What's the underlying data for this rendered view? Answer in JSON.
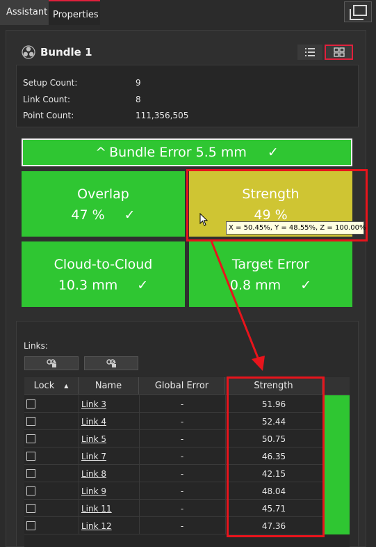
{
  "tabs": [
    {
      "label": "Assistant"
    },
    {
      "label": "Properties"
    }
  ],
  "bundle": {
    "title": "Bundle 1",
    "info": [
      {
        "key": "Setup Count:",
        "value": "9"
      },
      {
        "key": "Link Count:",
        "value": "8"
      },
      {
        "key": "Point Count:",
        "value": "111,356,505"
      }
    ]
  },
  "bundle_error": {
    "chevron": "^",
    "label": "Bundle Error 5.5 mm",
    "check": "✓"
  },
  "tiles": [
    {
      "label": "Overlap",
      "value": "47 %",
      "check": "✓",
      "color": "#2fc632"
    },
    {
      "label": "Strength",
      "value": "49 %",
      "check": "",
      "color": "#cfc533"
    },
    {
      "label": "Cloud-to-Cloud",
      "value": "10.3 mm",
      "check": "✓",
      "color": "#2fc632"
    },
    {
      "label": "Target Error",
      "value": "0.8 mm",
      "check": "✓",
      "color": "#2fc632"
    }
  ],
  "tooltip": "X = 50.45%, Y = 48.55%, Z = 100.00%",
  "links": {
    "label": "Links:",
    "columns": {
      "lock": "Lock",
      "name": "Name",
      "global_error": "Global Error",
      "strength": "Strength"
    },
    "rows": [
      {
        "name": "Link 3",
        "global_error": "-",
        "strength": "51.96"
      },
      {
        "name": "Link 4",
        "global_error": "-",
        "strength": "52.44"
      },
      {
        "name": "Link 5",
        "global_error": "-",
        "strength": "50.75"
      },
      {
        "name": "Link 7",
        "global_error": "-",
        "strength": "46.35"
      },
      {
        "name": "Link 8",
        "global_error": "-",
        "strength": "42.15"
      },
      {
        "name": "Link 9",
        "global_error": "-",
        "strength": "48.04"
      },
      {
        "name": "Link 11",
        "global_error": "-",
        "strength": "45.71"
      },
      {
        "name": "Link 12",
        "global_error": "-",
        "strength": "47.36"
      }
    ]
  },
  "colors": {
    "accent_red": "#e0203c",
    "status_green": "#2fc632",
    "status_yellow": "#cfc533",
    "annotation_red": "#e8141c"
  }
}
